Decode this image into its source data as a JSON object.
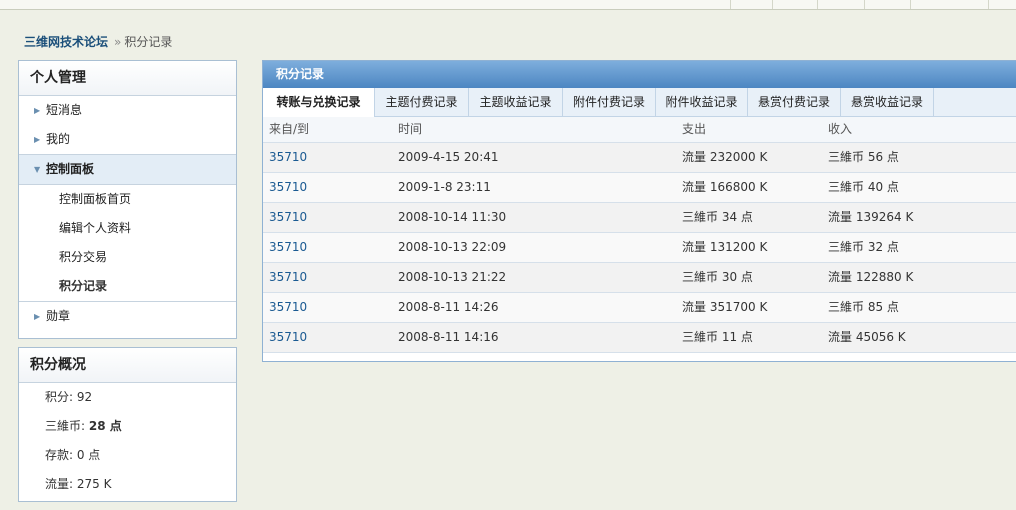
{
  "breadcrumb": {
    "home": "三维网技术论坛",
    "separator": "»",
    "current": "积分记录"
  },
  "sidebar": {
    "title": "个人管理",
    "items": [
      {
        "label": "短消息",
        "arrow": "▶"
      },
      {
        "label": "我的",
        "arrow": "▶"
      },
      {
        "label": "控制面板",
        "arrow": "▼"
      },
      {
        "label": "勋章",
        "arrow": "▶"
      }
    ],
    "subitems": [
      "控制面板首页",
      "编辑个人资料",
      "积分交易",
      "积分记录"
    ]
  },
  "summary": {
    "title": "积分概况",
    "rows": [
      {
        "label": "积分: ",
        "value": "92"
      },
      {
        "label": "三維币: ",
        "value": "28 点"
      },
      {
        "label": "存款: ",
        "value": "0 点"
      },
      {
        "label": "流量: ",
        "value": "275 K"
      }
    ]
  },
  "main": {
    "title": "积分记录",
    "tabs": [
      "转账与兑换记录",
      "主题付费记录",
      "主题收益记录",
      "附件付费记录",
      "附件收益记录",
      "悬赏付费记录",
      "悬赏收益记录"
    ],
    "columns": [
      "来自/到",
      "时间",
      "支出",
      "收入"
    ],
    "rows": [
      {
        "from": "35710",
        "time": "2009-4-15 20:41",
        "out": "流量  232000 K",
        "in": "三維币  56 点"
      },
      {
        "from": "35710",
        "time": "2009-1-8 23:11",
        "out": "流量  166800 K",
        "in": "三維币  40 点"
      },
      {
        "from": "35710",
        "time": "2008-10-14 11:30",
        "out": "三維币  34 点",
        "in": "流量  139264 K"
      },
      {
        "from": "35710",
        "time": "2008-10-13 22:09",
        "out": "流量  131200 K",
        "in": "三維币  32 点"
      },
      {
        "from": "35710",
        "time": "2008-10-13 21:22",
        "out": "三維币  30 点",
        "in": "流量  122880 K"
      },
      {
        "from": "35710",
        "time": "2008-8-11 14:26",
        "out": "流量  351700 K",
        "in": "三維币  85 点"
      },
      {
        "from": "35710",
        "time": "2008-8-11 14:16",
        "out": "三維币  11 点",
        "in": "流量  45056 K"
      }
    ]
  }
}
